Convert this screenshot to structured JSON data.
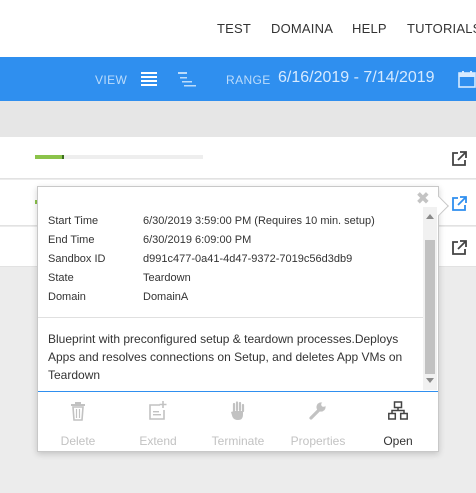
{
  "topnav": {
    "items": [
      "TEST",
      "DOMAINA",
      "HELP",
      "TUTORIALS"
    ]
  },
  "toolbar": {
    "view_label": "VIEW",
    "range_label": "RANGE",
    "range_value": "6/16/2019 - 7/14/2019"
  },
  "rows": [
    {
      "progress": 0.17
    },
    {
      "progress": 0.0
    },
    {
      "progress": 0.0
    }
  ],
  "popover": {
    "close_glyph": "✖",
    "details": [
      {
        "key": "Start Time",
        "value": "6/30/2019 3:59:00 PM (Requires 10 min. setup)"
      },
      {
        "key": "End Time",
        "value": "6/30/2019 6:09:00 PM"
      },
      {
        "key": "Sandbox ID",
        "value": "d991c477-0a41-4d47-9372-7019c56d3db9"
      },
      {
        "key": "State",
        "value": "Teardown"
      },
      {
        "key": "Domain",
        "value": "DomainA"
      }
    ],
    "description": "Blueprint with preconfigured setup & teardown processes.Deploys Apps and resolves connections on Setup, and deletes App VMs on Teardown",
    "actions": [
      {
        "label": "Delete",
        "icon": "trash-icon",
        "enabled": false
      },
      {
        "label": "Extend",
        "icon": "extend-icon",
        "enabled": false
      },
      {
        "label": "Terminate",
        "icon": "hand-icon",
        "enabled": false
      },
      {
        "label": "Properties",
        "icon": "wrench-icon",
        "enabled": false
      },
      {
        "label": "Open",
        "icon": "sitemap-icon",
        "enabled": true
      }
    ]
  },
  "colors": {
    "toolbar": "#2f8fef",
    "progress": "#8bc34a",
    "accent_link": "#2f8fef"
  }
}
